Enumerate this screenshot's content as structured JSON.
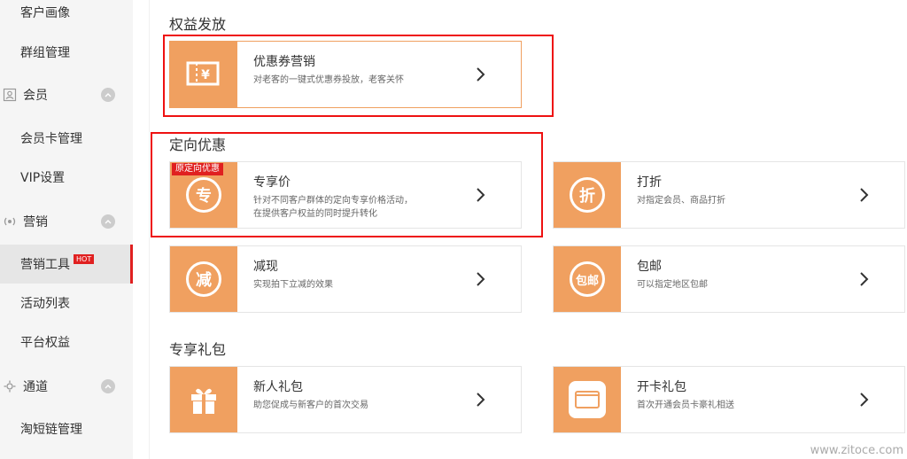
{
  "sidebar": {
    "items": [
      {
        "label": "客户画像"
      },
      {
        "label": "群组管理"
      },
      {
        "label": "会员"
      },
      {
        "label": "会员卡管理"
      },
      {
        "label": "VIP设置"
      },
      {
        "label": "营销"
      },
      {
        "label": "营销工具",
        "badge": "HOT"
      },
      {
        "label": "活动列表"
      },
      {
        "label": "平台权益"
      },
      {
        "label": "通道"
      },
      {
        "label": "淘短链管理"
      }
    ]
  },
  "sections": {
    "rights": {
      "title": "权益发放"
    },
    "targeted": {
      "title": "定向优惠"
    },
    "gift": {
      "title": "专享礼包"
    }
  },
  "cards": {
    "coupon": {
      "title": "优惠券营销",
      "desc": "对老客的一键式优惠券投放，老客关怀",
      "glyph": "¥"
    },
    "exclusive": {
      "title": "专享价",
      "desc1": "针对不同客户群体的定向专享价格活动，",
      "desc2": "在提供客户权益的同时提升转化",
      "badge": "原定向优惠",
      "glyph": "专"
    },
    "discount": {
      "title": "打折",
      "desc": "对指定会员、商品打折",
      "glyph": "折"
    },
    "reduce": {
      "title": "减现",
      "desc": "实现拍下立减的效果",
      "glyph": "减"
    },
    "freeship": {
      "title": "包邮",
      "desc": "可以指定地区包邮",
      "glyph": "包邮"
    },
    "newgift": {
      "title": "新人礼包",
      "desc": "助您促成与新客户的首次交易"
    },
    "cardgift": {
      "title": "开卡礼包",
      "desc": "首次开通会员卡豪礼相送"
    }
  },
  "watermark": "www.zitoce.com",
  "colors": {
    "accent": "#f0a060",
    "highlight": "#e02020",
    "sidebar": "#f5f5f5"
  }
}
